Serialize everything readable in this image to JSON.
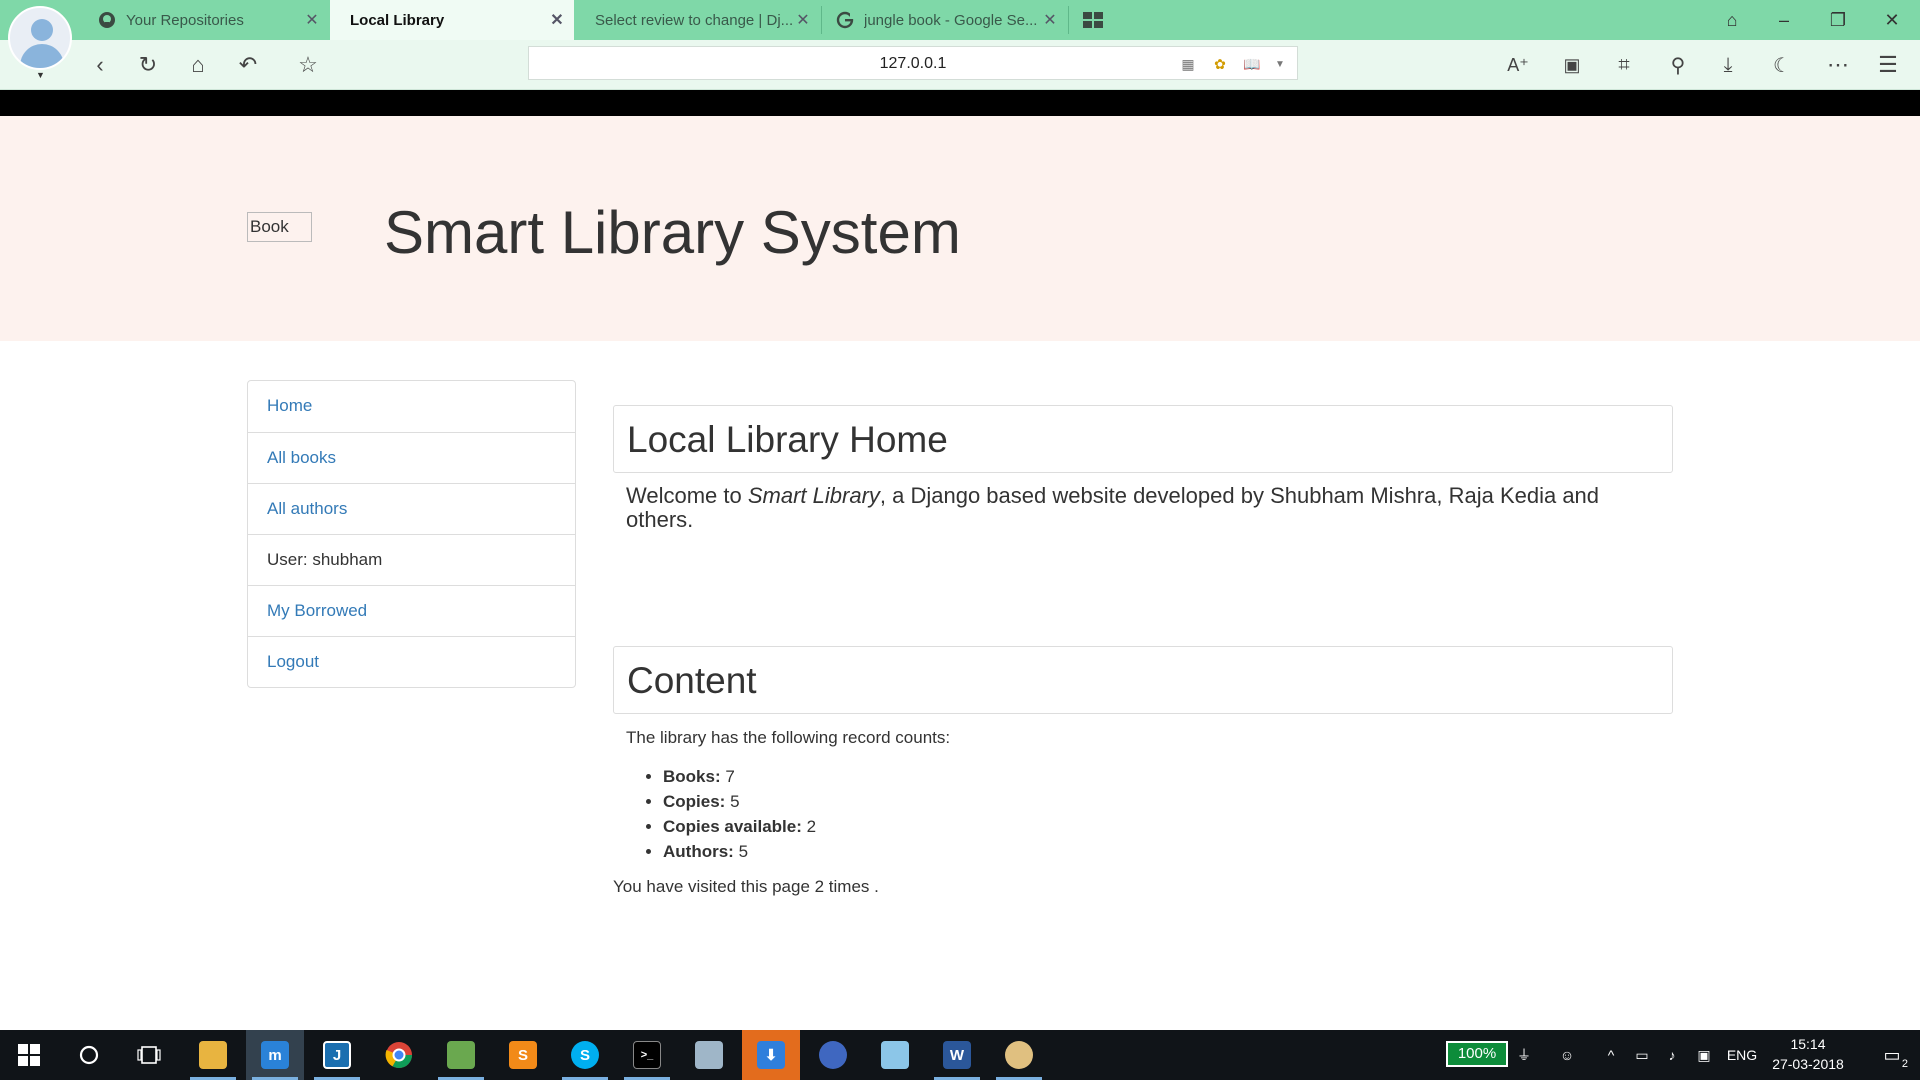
{
  "browser": {
    "tabs": [
      {
        "title": "Your Repositories",
        "icon": "github-icon"
      },
      {
        "title": "Local Library",
        "icon": "none"
      },
      {
        "title": "Select review to change | Dj...",
        "icon": "none"
      },
      {
        "title": "jungle book - Google Se...",
        "icon": "google-icon"
      }
    ],
    "address": "127.0.0.1"
  },
  "header": {
    "logo_alt": "Book",
    "site_title": "Smart Library System"
  },
  "sidebar": {
    "items": [
      {
        "label": "Home"
      },
      {
        "label": "All books"
      },
      {
        "label": "All authors"
      },
      {
        "label": "User: shubham"
      },
      {
        "label": "My Borrowed"
      },
      {
        "label": "Logout"
      }
    ]
  },
  "main": {
    "home_heading": "Local Library Home",
    "welcome_prefix": "Welcome to ",
    "welcome_em": "Smart Library",
    "welcome_suffix": ", a Django based website developed by Shubham Mishra, Raja Kedia and others.",
    "content_heading": "Content",
    "counts_intro": "The library has the following record counts:",
    "counts": [
      {
        "label": "Books:",
        "value": "7"
      },
      {
        "label": "Copies:",
        "value": "5"
      },
      {
        "label": "Copies available:",
        "value": "2"
      },
      {
        "label": "Authors:",
        "value": "5"
      }
    ],
    "visited": "You have visited this page 2 times ."
  },
  "taskbar": {
    "battery": "100%",
    "language": "ENG",
    "time": "15:14",
    "date": "27-03-2018",
    "notifications": "2"
  },
  "colors": {
    "tabbar": "#7fd8a8",
    "toolbar": "#eaf8ef",
    "jumbotron": "#fdf2ee",
    "link": "#337ab7",
    "taskbar": "#101418"
  }
}
